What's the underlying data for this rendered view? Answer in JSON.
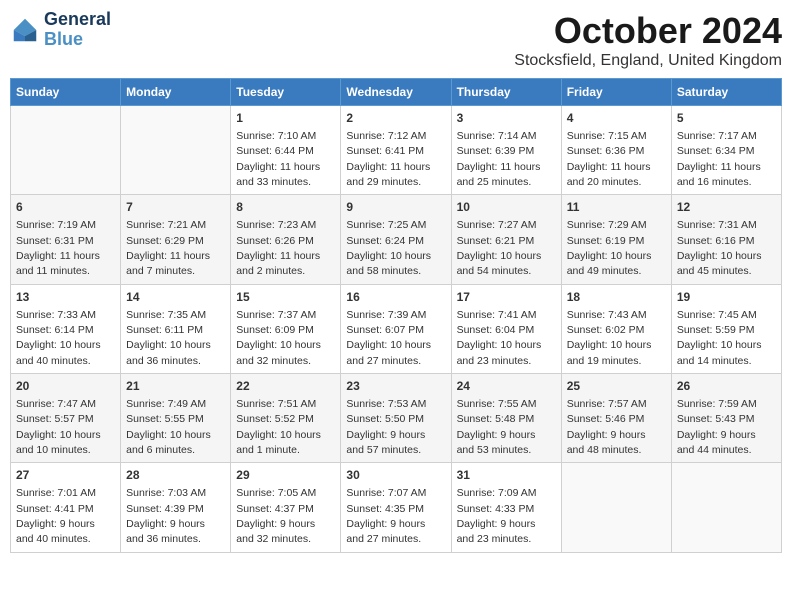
{
  "header": {
    "logo_line1": "General",
    "logo_line2": "Blue",
    "month": "October 2024",
    "location": "Stocksfield, England, United Kingdom"
  },
  "days_of_week": [
    "Sunday",
    "Monday",
    "Tuesday",
    "Wednesday",
    "Thursday",
    "Friday",
    "Saturday"
  ],
  "weeks": [
    [
      {
        "day": "",
        "sunrise": "",
        "sunset": "",
        "daylight": ""
      },
      {
        "day": "",
        "sunrise": "",
        "sunset": "",
        "daylight": ""
      },
      {
        "day": "1",
        "sunrise": "Sunrise: 7:10 AM",
        "sunset": "Sunset: 6:44 PM",
        "daylight": "Daylight: 11 hours and 33 minutes."
      },
      {
        "day": "2",
        "sunrise": "Sunrise: 7:12 AM",
        "sunset": "Sunset: 6:41 PM",
        "daylight": "Daylight: 11 hours and 29 minutes."
      },
      {
        "day": "3",
        "sunrise": "Sunrise: 7:14 AM",
        "sunset": "Sunset: 6:39 PM",
        "daylight": "Daylight: 11 hours and 25 minutes."
      },
      {
        "day": "4",
        "sunrise": "Sunrise: 7:15 AM",
        "sunset": "Sunset: 6:36 PM",
        "daylight": "Daylight: 11 hours and 20 minutes."
      },
      {
        "day": "5",
        "sunrise": "Sunrise: 7:17 AM",
        "sunset": "Sunset: 6:34 PM",
        "daylight": "Daylight: 11 hours and 16 minutes."
      }
    ],
    [
      {
        "day": "6",
        "sunrise": "Sunrise: 7:19 AM",
        "sunset": "Sunset: 6:31 PM",
        "daylight": "Daylight: 11 hours and 11 minutes."
      },
      {
        "day": "7",
        "sunrise": "Sunrise: 7:21 AM",
        "sunset": "Sunset: 6:29 PM",
        "daylight": "Daylight: 11 hours and 7 minutes."
      },
      {
        "day": "8",
        "sunrise": "Sunrise: 7:23 AM",
        "sunset": "Sunset: 6:26 PM",
        "daylight": "Daylight: 11 hours and 2 minutes."
      },
      {
        "day": "9",
        "sunrise": "Sunrise: 7:25 AM",
        "sunset": "Sunset: 6:24 PM",
        "daylight": "Daylight: 10 hours and 58 minutes."
      },
      {
        "day": "10",
        "sunrise": "Sunrise: 7:27 AM",
        "sunset": "Sunset: 6:21 PM",
        "daylight": "Daylight: 10 hours and 54 minutes."
      },
      {
        "day": "11",
        "sunrise": "Sunrise: 7:29 AM",
        "sunset": "Sunset: 6:19 PM",
        "daylight": "Daylight: 10 hours and 49 minutes."
      },
      {
        "day": "12",
        "sunrise": "Sunrise: 7:31 AM",
        "sunset": "Sunset: 6:16 PM",
        "daylight": "Daylight: 10 hours and 45 minutes."
      }
    ],
    [
      {
        "day": "13",
        "sunrise": "Sunrise: 7:33 AM",
        "sunset": "Sunset: 6:14 PM",
        "daylight": "Daylight: 10 hours and 40 minutes."
      },
      {
        "day": "14",
        "sunrise": "Sunrise: 7:35 AM",
        "sunset": "Sunset: 6:11 PM",
        "daylight": "Daylight: 10 hours and 36 minutes."
      },
      {
        "day": "15",
        "sunrise": "Sunrise: 7:37 AM",
        "sunset": "Sunset: 6:09 PM",
        "daylight": "Daylight: 10 hours and 32 minutes."
      },
      {
        "day": "16",
        "sunrise": "Sunrise: 7:39 AM",
        "sunset": "Sunset: 6:07 PM",
        "daylight": "Daylight: 10 hours and 27 minutes."
      },
      {
        "day": "17",
        "sunrise": "Sunrise: 7:41 AM",
        "sunset": "Sunset: 6:04 PM",
        "daylight": "Daylight: 10 hours and 23 minutes."
      },
      {
        "day": "18",
        "sunrise": "Sunrise: 7:43 AM",
        "sunset": "Sunset: 6:02 PM",
        "daylight": "Daylight: 10 hours and 19 minutes."
      },
      {
        "day": "19",
        "sunrise": "Sunrise: 7:45 AM",
        "sunset": "Sunset: 5:59 PM",
        "daylight": "Daylight: 10 hours and 14 minutes."
      }
    ],
    [
      {
        "day": "20",
        "sunrise": "Sunrise: 7:47 AM",
        "sunset": "Sunset: 5:57 PM",
        "daylight": "Daylight: 10 hours and 10 minutes."
      },
      {
        "day": "21",
        "sunrise": "Sunrise: 7:49 AM",
        "sunset": "Sunset: 5:55 PM",
        "daylight": "Daylight: 10 hours and 6 minutes."
      },
      {
        "day": "22",
        "sunrise": "Sunrise: 7:51 AM",
        "sunset": "Sunset: 5:52 PM",
        "daylight": "Daylight: 10 hours and 1 minute."
      },
      {
        "day": "23",
        "sunrise": "Sunrise: 7:53 AM",
        "sunset": "Sunset: 5:50 PM",
        "daylight": "Daylight: 9 hours and 57 minutes."
      },
      {
        "day": "24",
        "sunrise": "Sunrise: 7:55 AM",
        "sunset": "Sunset: 5:48 PM",
        "daylight": "Daylight: 9 hours and 53 minutes."
      },
      {
        "day": "25",
        "sunrise": "Sunrise: 7:57 AM",
        "sunset": "Sunset: 5:46 PM",
        "daylight": "Daylight: 9 hours and 48 minutes."
      },
      {
        "day": "26",
        "sunrise": "Sunrise: 7:59 AM",
        "sunset": "Sunset: 5:43 PM",
        "daylight": "Daylight: 9 hours and 44 minutes."
      }
    ],
    [
      {
        "day": "27",
        "sunrise": "Sunrise: 7:01 AM",
        "sunset": "Sunset: 4:41 PM",
        "daylight": "Daylight: 9 hours and 40 minutes."
      },
      {
        "day": "28",
        "sunrise": "Sunrise: 7:03 AM",
        "sunset": "Sunset: 4:39 PM",
        "daylight": "Daylight: 9 hours and 36 minutes."
      },
      {
        "day": "29",
        "sunrise": "Sunrise: 7:05 AM",
        "sunset": "Sunset: 4:37 PM",
        "daylight": "Daylight: 9 hours and 32 minutes."
      },
      {
        "day": "30",
        "sunrise": "Sunrise: 7:07 AM",
        "sunset": "Sunset: 4:35 PM",
        "daylight": "Daylight: 9 hours and 27 minutes."
      },
      {
        "day": "31",
        "sunrise": "Sunrise: 7:09 AM",
        "sunset": "Sunset: 4:33 PM",
        "daylight": "Daylight: 9 hours and 23 minutes."
      },
      {
        "day": "",
        "sunrise": "",
        "sunset": "",
        "daylight": ""
      },
      {
        "day": "",
        "sunrise": "",
        "sunset": "",
        "daylight": ""
      }
    ]
  ]
}
